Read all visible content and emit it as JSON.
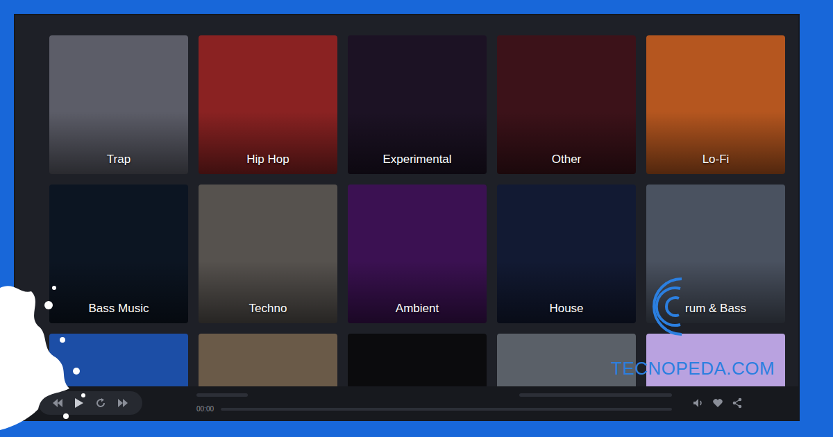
{
  "tiles": [
    {
      "label": "Trap",
      "color": "#5c5d68"
    },
    {
      "label": "Hip Hop",
      "color": "#8a2222"
    },
    {
      "label": "Experimental",
      "color": "#1c1224"
    },
    {
      "label": "Other",
      "color": "#3c1219"
    },
    {
      "label": "Lo-Fi",
      "color": "#b5561f"
    },
    {
      "label": "Bass Music",
      "color": "#0c1522"
    },
    {
      "label": "Techno",
      "color": "#56524e"
    },
    {
      "label": "Ambient",
      "color": "#3b1152"
    },
    {
      "label": "House",
      "color": "#121a33"
    },
    {
      "label": "rum & Bass",
      "color": "#4a5260"
    },
    {
      "color": "#1c4ea6"
    },
    {
      "color": "#6a5a48"
    },
    {
      "color": "#0b0b0d"
    },
    {
      "color": "#5a6068"
    },
    {
      "color": "#b9a2e0"
    }
  ],
  "player": {
    "time": "00:00",
    "progress": {
      "level": 0
    }
  },
  "watermark": "TECNOPEDA.COM"
}
